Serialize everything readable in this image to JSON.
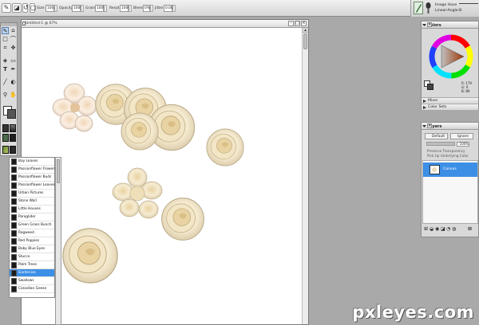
{
  "toolbar": {
    "size_label": "Size:",
    "size_value": "100.0",
    "opacity_label": "Opacity:",
    "opacity_value": "100%",
    "grain_label": "Grain:",
    "grain_value": "100%",
    "resat_label": "Resat:",
    "resat_value": "100%",
    "bleed_label": "Bleed:",
    "bleed_value": "0%",
    "jitter_label": "Jitter:",
    "jitter_value": "0.00"
  },
  "brush": {
    "category": "Image Hose",
    "variant": "Linear-Angle-B"
  },
  "document": {
    "title": "Untitled-1 @ 67%"
  },
  "colors_panel": {
    "title": "Colors",
    "readout": [
      "R: 179",
      "G: 0",
      "B: 89"
    ],
    "mixer_label": "Mixer",
    "color_sets_label": "Color Sets",
    "hue_color": "#d44a0a"
  },
  "layers_panel": {
    "title": "Layers",
    "composite_method": "Default",
    "opacity_mode": "Ignore",
    "opacity_value": "100%",
    "preserve_transparency": "Preserve Transparency",
    "pick_up_underlying": "Pick Up Underlying Color",
    "layer_name": "Canvas"
  },
  "patterns": [
    {
      "name": "Bay Leaves",
      "selected": false
    },
    {
      "name": "Passionflower Flowers",
      "selected": false
    },
    {
      "name": "Passionflower Buds",
      "selected": false
    },
    {
      "name": "Passionflower Leaves",
      "selected": false
    },
    {
      "name": "Urban Pictures",
      "selected": false
    },
    {
      "name": "Stone Wall",
      "selected": false
    },
    {
      "name": "Little Houses",
      "selected": false
    },
    {
      "name": "Paraglider",
      "selected": false
    },
    {
      "name": "Green Grass Bunch",
      "selected": false
    },
    {
      "name": "Ragweed",
      "selected": false
    },
    {
      "name": "Red Poppies",
      "selected": false
    },
    {
      "name": "Baby Blue Eyes",
      "selected": false
    },
    {
      "name": "Stucco",
      "selected": false
    },
    {
      "name": "Palm Trees",
      "selected": false
    },
    {
      "name": "Gardenias",
      "selected": true
    },
    {
      "name": "Swallows",
      "selected": false
    },
    {
      "name": "Canadian Geese",
      "selected": false
    }
  ],
  "watermark": "pxleyes.com"
}
